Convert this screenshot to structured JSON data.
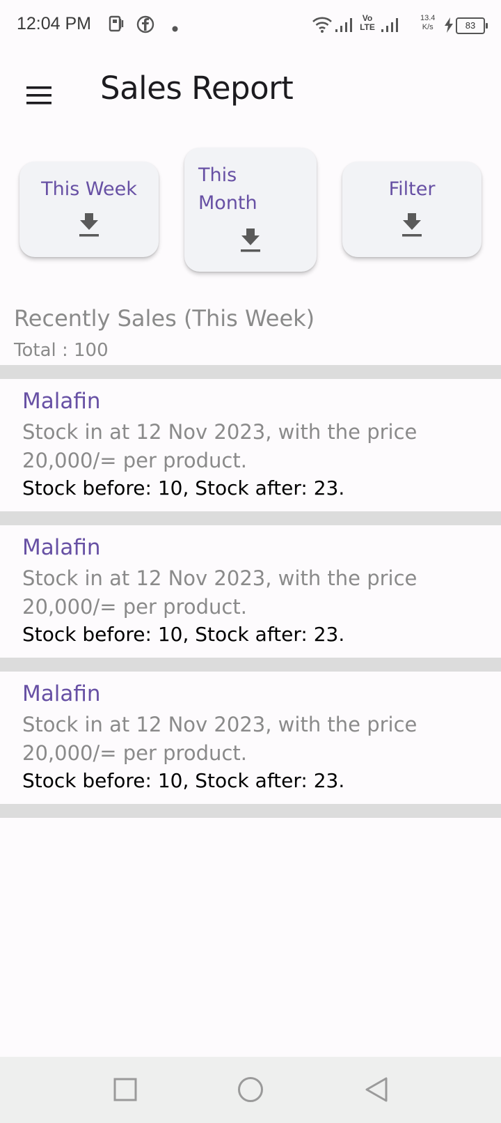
{
  "status_bar": {
    "time": "12:04 PM",
    "net_speed_value": "13.4",
    "net_speed_unit": "K/s",
    "battery": "83",
    "volte": "Vo LTE",
    "icons": [
      "notes-app-icon",
      "facebook-icon",
      "dot-icon",
      "wifi-icon",
      "signal-icon",
      "volte-icon",
      "signal-icon",
      "charging-icon",
      "battery-icon"
    ]
  },
  "app_bar": {
    "title": "Sales Report",
    "menu_icon": "hamburger-menu-icon"
  },
  "export_buttons": [
    {
      "label": "This Week",
      "icon": "download-icon"
    },
    {
      "label": "This Month",
      "icon": "download-icon"
    },
    {
      "label": "Filter",
      "icon": "download-icon"
    }
  ],
  "section": {
    "title": "Recently Sales (This Week)",
    "total": "Total : 100"
  },
  "sales": [
    {
      "name": "Malafin",
      "description": "Stock in at 12 Nov 2023, with the price 20,000/= per product.",
      "stock": "Stock before: 10, Stock after: 23."
    },
    {
      "name": "Malafin",
      "description": "Stock in at 12 Nov 2023, with the price 20,000/= per product.",
      "stock": "Stock before: 10, Stock after: 23."
    },
    {
      "name": "Malafin",
      "description": "Stock in at 12 Nov 2023, with the price 20,000/= per product.",
      "stock": "Stock before: 10, Stock after: 23."
    }
  ],
  "colors": {
    "accent": "#6750a4",
    "secondary_text": "#8a8a8a",
    "divider": "#dcdcdc",
    "card_bg": "#f2f3f6",
    "nav_bg": "#eeefee"
  },
  "nav_bar": {
    "icons": [
      "recents-square-icon",
      "home-circle-icon",
      "back-triangle-icon"
    ]
  }
}
